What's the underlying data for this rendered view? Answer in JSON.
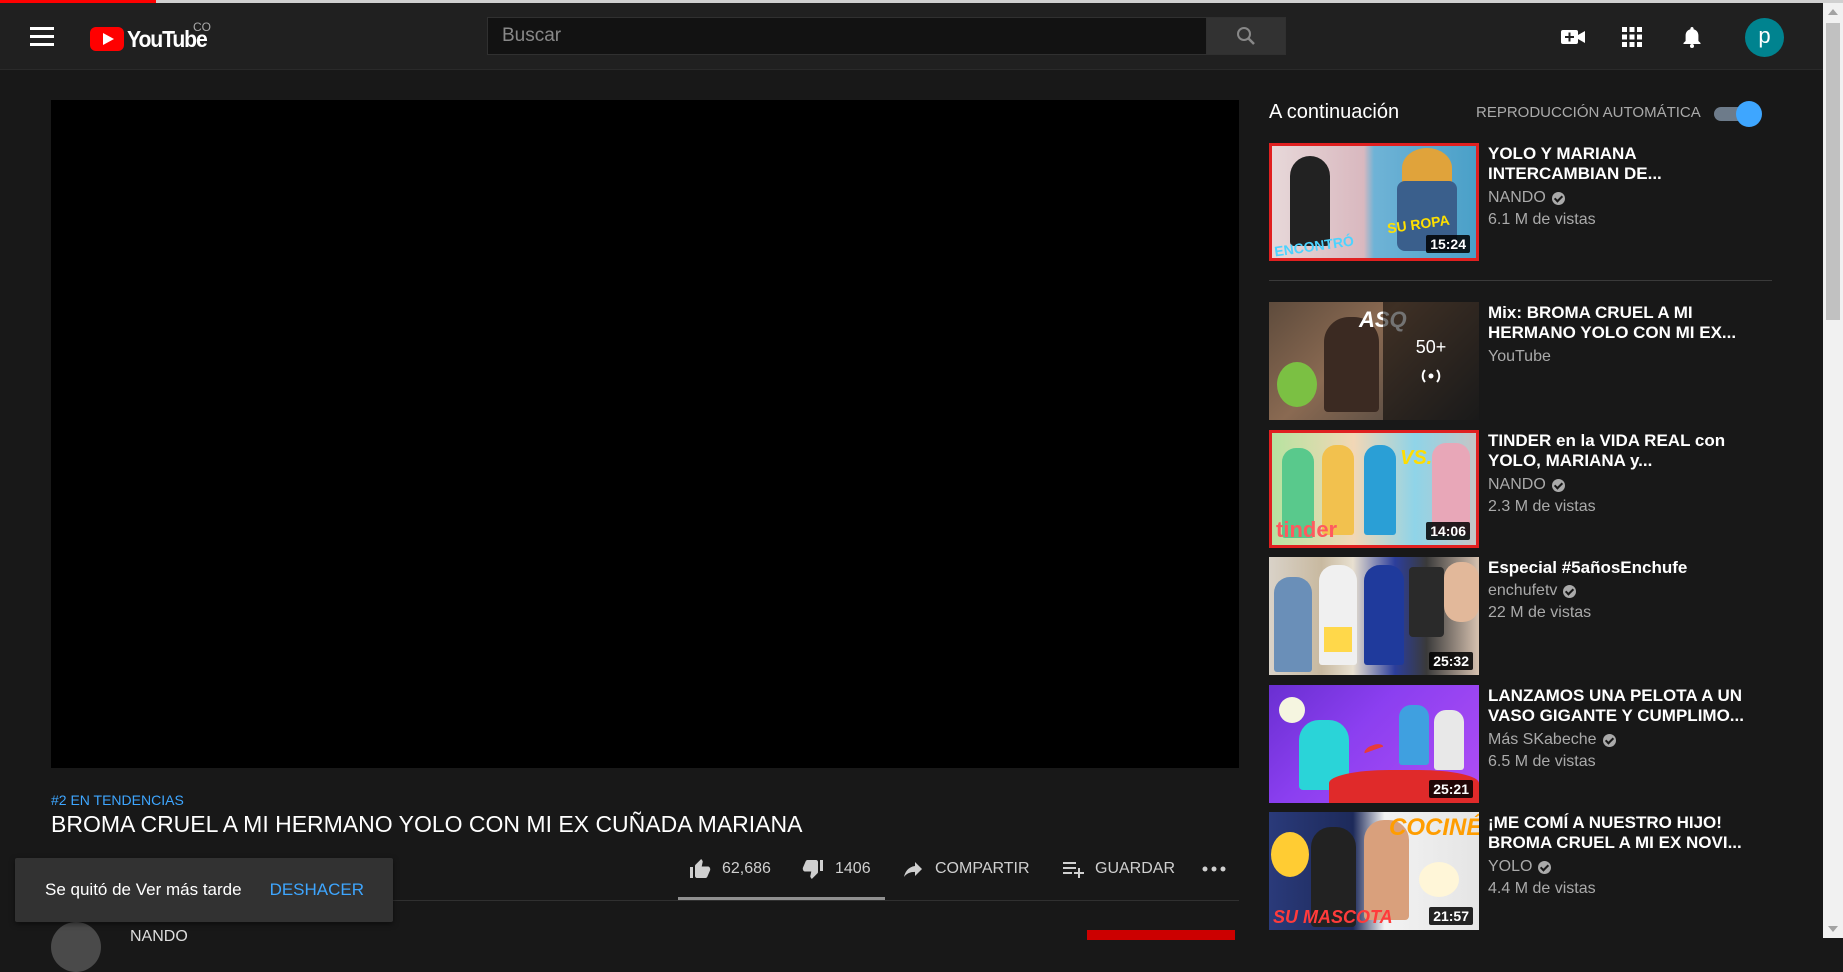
{
  "header": {
    "logo_text": "YouTube",
    "country_code": "CO",
    "search_placeholder": "Buscar",
    "avatar_letter": "p"
  },
  "video": {
    "trending_label": "#2 EN TENDENCIAS",
    "title": "BROMA CRUEL A MI HERMANO YOLO CON MI EX CUÑADA MARIANA",
    "likes": "62,686",
    "dislikes": "1406",
    "share_label": "COMPARTIR",
    "save_label": "GUARDAR",
    "channel_name_partial": "NANDO"
  },
  "toast": {
    "message": "Se quitó de Ver más tarde",
    "undo_label": "DESHACER"
  },
  "sidebar": {
    "upnext_title": "A continuación",
    "autoplay_label": "REPRODUCCIÓN AUTOMÁTICA",
    "autoplay_on": true,
    "videos": [
      {
        "title": "YOLO Y MARIANA INTERCAMBIAN DE...",
        "channel": "NANDO",
        "verified": true,
        "views": "6.1 M de vistas",
        "duration": "15:24"
      },
      {
        "title": "Mix: BROMA CRUEL A MI HERMANO YOLO CON MI EX...",
        "channel": "YouTube",
        "verified": false,
        "views": "",
        "duration": "",
        "mix_count": "50+"
      },
      {
        "title": "TINDER en la VIDA REAL con YOLO, MARIANA y...",
        "channel": "NANDO",
        "verified": true,
        "views": "2.3 M de vistas",
        "duration": "14:06"
      },
      {
        "title": "Especial #5añosEnchufe",
        "channel": "enchufetv",
        "verified": true,
        "views": "22 M de vistas",
        "duration": "25:32"
      },
      {
        "title": "LANZAMOS UNA PELOTA A UN VASO GIGANTE Y CUMPLIMO...",
        "channel": "Más SKabeche",
        "verified": true,
        "views": "6.5 M de vistas",
        "duration": "25:21"
      },
      {
        "title": "¡ME COMÍ A NUESTRO HIJO! BROMA CRUEL A MI EX NOVI...",
        "channel": "YOLO",
        "verified": true,
        "views": "4.4 M de vistas",
        "duration": "21:57"
      }
    ]
  },
  "colors": {
    "background": "#181818",
    "header": "#202020",
    "accent_blue": "#3ea6ff",
    "youtube_red": "#ff0000"
  }
}
